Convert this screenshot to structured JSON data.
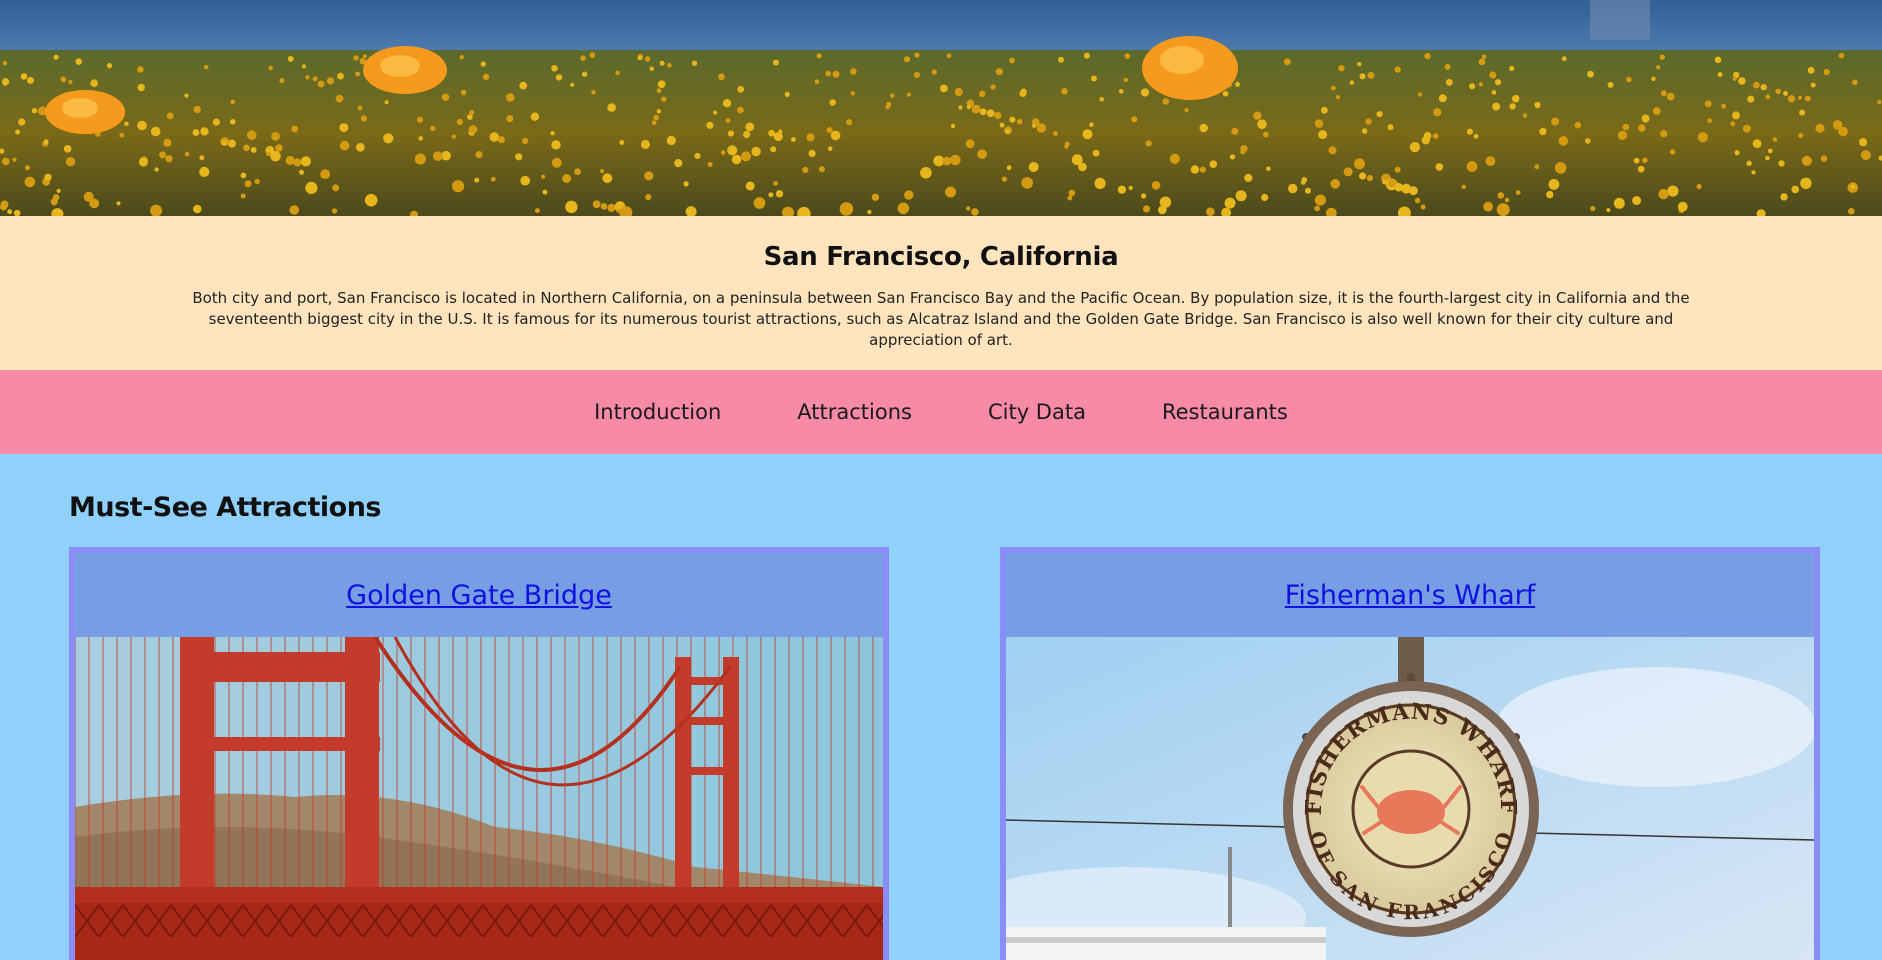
{
  "header": {
    "title": "San Francisco, California",
    "description": "Both city and port, San Francisco is located in Northern California, on a peninsula between San Francisco Bay and the Pacific Ocean. By population size, it is the fourth-largest city in California and the seventeenth biggest city in the U.S. It is famous for its numerous tourist attractions, such as Alcatraz Island and the Golden Gate Bridge. San Francisco is also well known for their city culture and appreciation of art."
  },
  "nav": {
    "items": [
      {
        "label": "Introduction"
      },
      {
        "label": "Attractions"
      },
      {
        "label": "City Data"
      },
      {
        "label": "Restaurants"
      }
    ]
  },
  "main": {
    "heading": "Must-See Attractions",
    "cards": [
      {
        "title": "Golden Gate Bridge"
      },
      {
        "title": "Fisherman's Wharf"
      }
    ]
  },
  "sign": {
    "line1": "FISHERMANS WHARF",
    "line2": "OF SAN FRANCISCO"
  },
  "colors": {
    "intro_bg": "#ffe4bd",
    "nav_bg": "#f78aa6",
    "main_bg": "#8fd1fa",
    "card_bg": "#779ee4",
    "card_border": "#8a8df5",
    "link": "#1010e0"
  }
}
